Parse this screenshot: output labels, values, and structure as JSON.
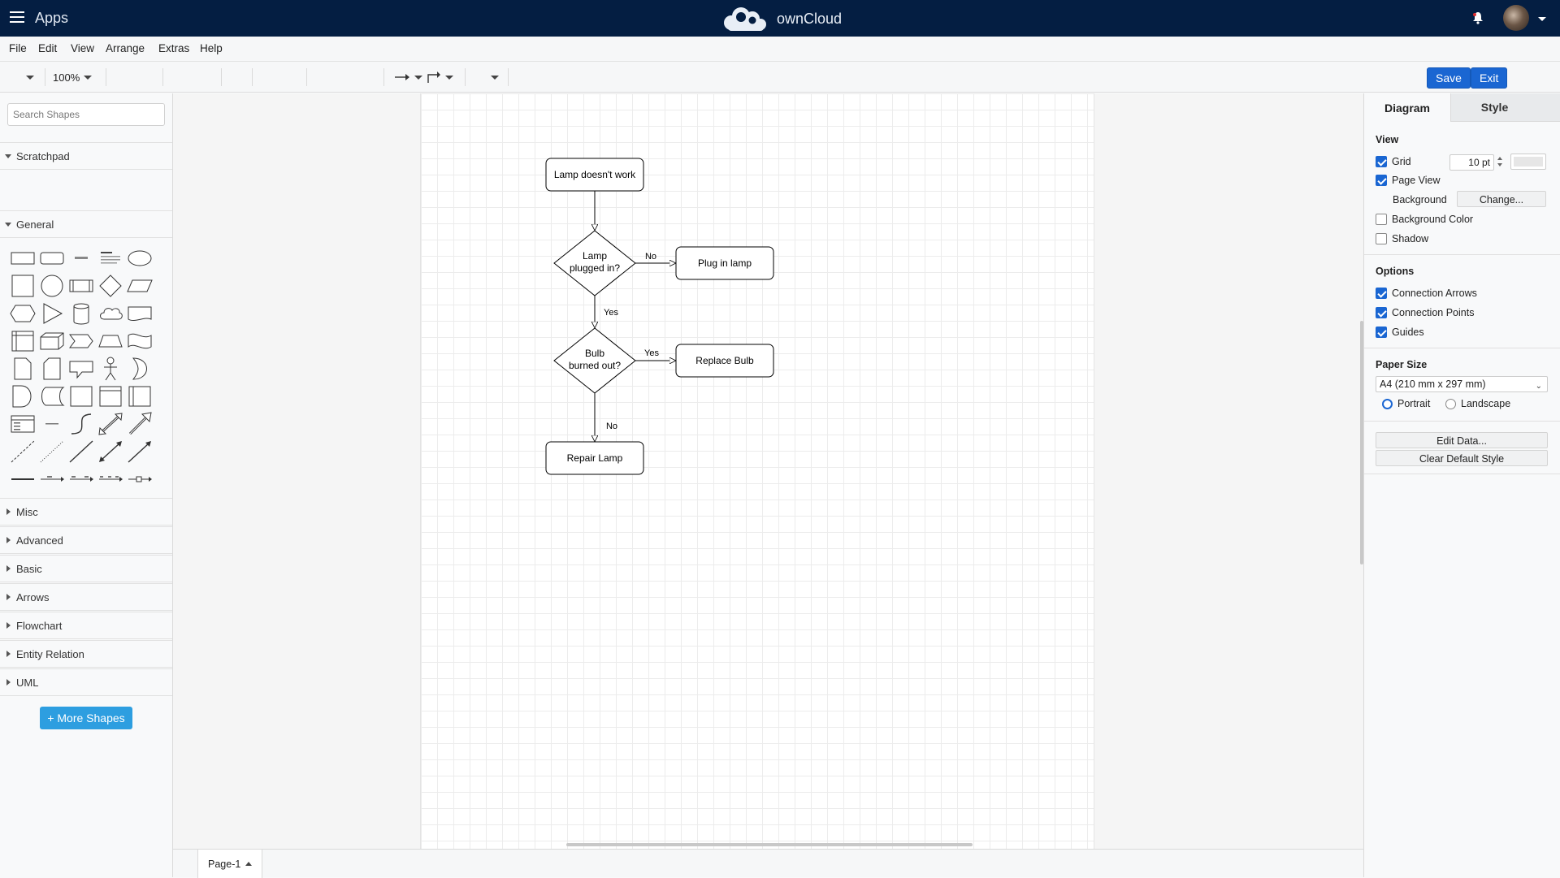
{
  "app": {
    "apps_label": "Apps",
    "brand": "ownCloud"
  },
  "menu": [
    "File",
    "Edit",
    "View",
    "Arrange",
    "Extras",
    "Help"
  ],
  "toolbar": {
    "zoom": "100%",
    "save_label": "Save",
    "exit_label": "Exit"
  },
  "sidebar": {
    "search_placeholder": "Search Shapes",
    "scratchpad": "Scratchpad",
    "general": "General",
    "collapsed_sections": [
      "Misc",
      "Advanced",
      "Basic",
      "Arrows",
      "Flowchart",
      "Entity Relation",
      "UML"
    ],
    "more_shapes": "+ More Shapes"
  },
  "diagram": {
    "nodes": {
      "start": "Lamp doesn't work",
      "plugged_line1": "Lamp",
      "plugged_line2": "plugged in?",
      "plug_in": "Plug in lamp",
      "bulb_line1": "Bulb",
      "bulb_line2": "burned out?",
      "replace": "Replace Bulb",
      "repair": "Repair Lamp"
    },
    "edges": {
      "no1": "No",
      "yes1": "Yes",
      "yes2": "Yes",
      "no2": "No"
    }
  },
  "page_tab": "Page-1",
  "panel": {
    "tab_diagram": "Diagram",
    "tab_style": "Style",
    "view_title": "View",
    "grid": "Grid",
    "grid_size": "10 pt",
    "page_view": "Page View",
    "background": "Background",
    "change": "Change...",
    "background_color": "Background Color",
    "shadow": "Shadow",
    "options_title": "Options",
    "connection_arrows": "Connection Arrows",
    "connection_points": "Connection Points",
    "guides": "Guides",
    "paper_size_title": "Paper Size",
    "paper_size": "A4 (210 mm x 297 mm)",
    "portrait": "Portrait",
    "landscape": "Landscape",
    "edit_data": "Edit Data...",
    "clear_default_style": "Clear Default Style"
  },
  "colors": {
    "topbar": "#041e42",
    "primary_button": "#1a66d2",
    "more_shapes_button": "#2d9ee0"
  }
}
